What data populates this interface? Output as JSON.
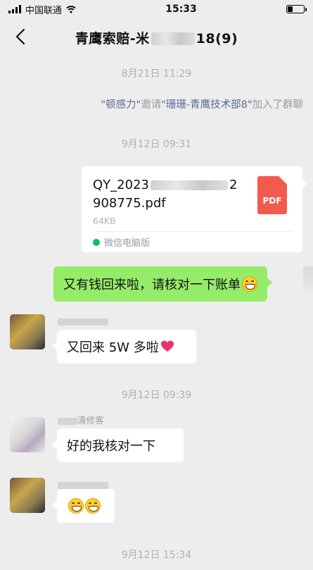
{
  "status_bar": {
    "carrier": "中国联通",
    "time": "15:33"
  },
  "header": {
    "title_prefix": "青鹰索赔-米",
    "title_suffix": "18(9)"
  },
  "messages": {
    "ts1": "8月21日 11:29",
    "system_invite": {
      "inviter": "\"顿感力\"",
      "verb": "邀请",
      "invitee": "\"珊珊-青鹰技术部8\"",
      "tail": "加入了群聊"
    },
    "ts2": "9月12日 09:31",
    "file": {
      "name_line1": "QY_2023",
      "name_line1_end": "2",
      "name_line2": "908775.pdf",
      "size": "64KB",
      "type_label": "PDF",
      "source": "微信电脑版"
    },
    "outgoing_1": "又有钱回来啦，请核对一下账单",
    "incoming_1": "又回来 5W 多啦",
    "ts3": "9月12日 09:39",
    "sender_2": "清修客",
    "incoming_2": "好的我核对一下",
    "ts4": "9月12日 15:34"
  },
  "colors": {
    "background": "#ededed",
    "outgoing_bubble": "#95ec69",
    "link": "#576b95",
    "pdf": "#f25a4d"
  },
  "icons": [
    "signal-icon",
    "wifi-icon",
    "battery-icon",
    "back-chevron-icon",
    "pdf-file-icon",
    "wechat-pc-icon",
    "grinning-emoji",
    "heart-emoji"
  ]
}
